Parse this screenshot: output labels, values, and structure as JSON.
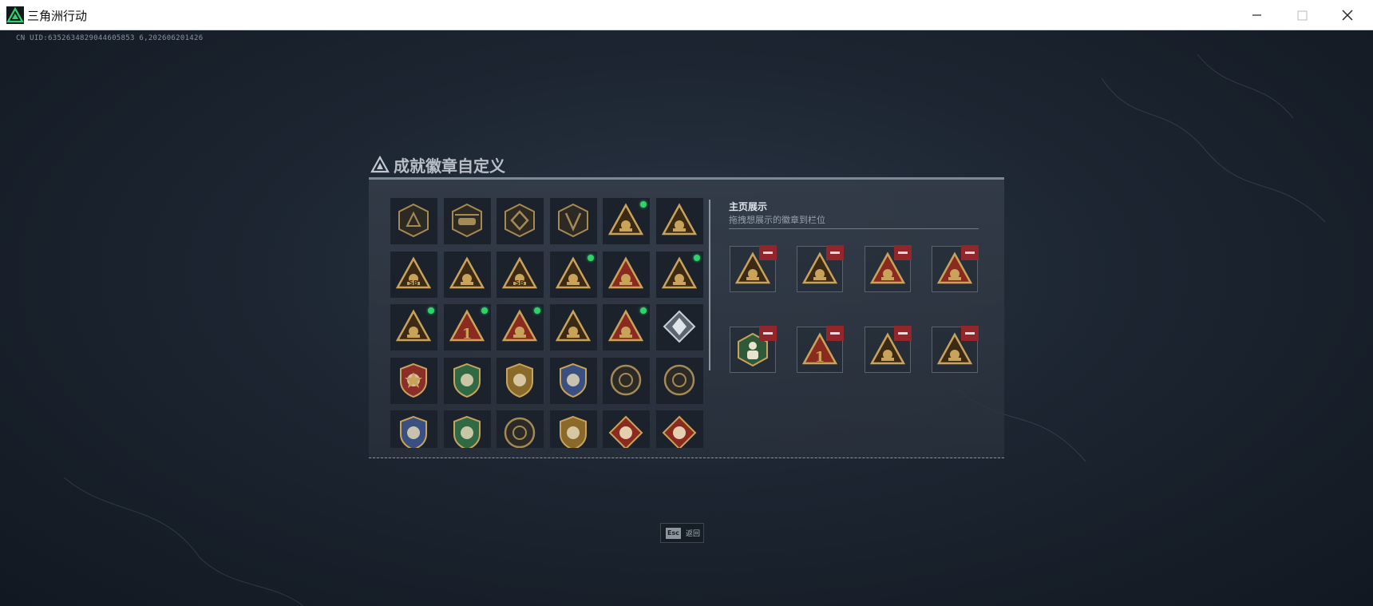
{
  "window": {
    "title": "三角洲行动"
  },
  "uid_text": "CN UID:6352634829044605853 6,202606201426",
  "dialog": {
    "title": "成就徽章自定义",
    "display": {
      "title": "主页展示",
      "subtitle": "拖拽想展示的徽章到栏位"
    }
  },
  "badge_grid": [
    {
      "icon": "tactical-triangle-badge",
      "new": false
    },
    {
      "icon": "helicopter-badge",
      "new": false
    },
    {
      "icon": "diamond-emblem-badge",
      "new": false
    },
    {
      "icon": "arrow-shield-badge",
      "new": false
    },
    {
      "icon": "gold-triangle-crest-badge",
      "new": true
    },
    {
      "icon": "gold-triangle-mask-badge",
      "new": false
    },
    {
      "icon": "gold-triangle-sb-badge",
      "new": false
    },
    {
      "icon": "gold-triangle-tower-badge",
      "new": false
    },
    {
      "icon": "gold-triangle-sb-badge",
      "new": false
    },
    {
      "icon": "gold-triangle-robot-badge",
      "new": true
    },
    {
      "icon": "red-triangle-rocket-badge",
      "new": false
    },
    {
      "icon": "gold-triangle-medal-badge",
      "new": true
    },
    {
      "icon": "gold-triangle-boat-badge",
      "new": true
    },
    {
      "icon": "red-triangle-one-badge",
      "new": true
    },
    {
      "icon": "red-triangle-cup-badge",
      "new": true
    },
    {
      "icon": "gold-triangle-dog-badge",
      "new": false
    },
    {
      "icon": "red-triangle-rocket-badge",
      "new": true
    },
    {
      "icon": "silver-cube-badge",
      "new": false
    },
    {
      "icon": "star-shield-badge",
      "new": false
    },
    {
      "icon": "green-shield-badge",
      "new": false
    },
    {
      "icon": "gold-shield-badge",
      "new": false
    },
    {
      "icon": "blue-shield-badge",
      "new": false
    },
    {
      "icon": "skull-round-badge",
      "new": false
    },
    {
      "icon": "skull-round-badge",
      "new": false
    },
    {
      "icon": "blue-wing-shield-badge",
      "new": false
    },
    {
      "icon": "green-wing-shield-badge",
      "new": false
    },
    {
      "icon": "dark-ring-badge",
      "new": false
    },
    {
      "icon": "gold-wing-shield-badge",
      "new": false
    },
    {
      "icon": "red-diamond-beast-badge",
      "new": false
    },
    {
      "icon": "red-diamond-beast-badge",
      "new": false
    }
  ],
  "display_slots": [
    {
      "icon": "gold-triangle-medal-badge"
    },
    {
      "icon": "gold-triangle-boat-badge"
    },
    {
      "icon": "red-triangle-cup-badge"
    },
    {
      "icon": "red-triangle-rocket-badge"
    },
    {
      "icon": "green-hex-figure-badge"
    },
    {
      "icon": "red-triangle-one-badge"
    },
    {
      "icon": "gold-triangle-crest-badge"
    },
    {
      "icon": "gold-triangle-robot-badge"
    }
  ],
  "esc": {
    "key": "Esc",
    "label": "返回"
  },
  "colors": {
    "accent_green": "#2fd36a",
    "remove_red": "#93262b",
    "badge_gold": "#c9a35a",
    "badge_red": "#8b2b1f"
  }
}
